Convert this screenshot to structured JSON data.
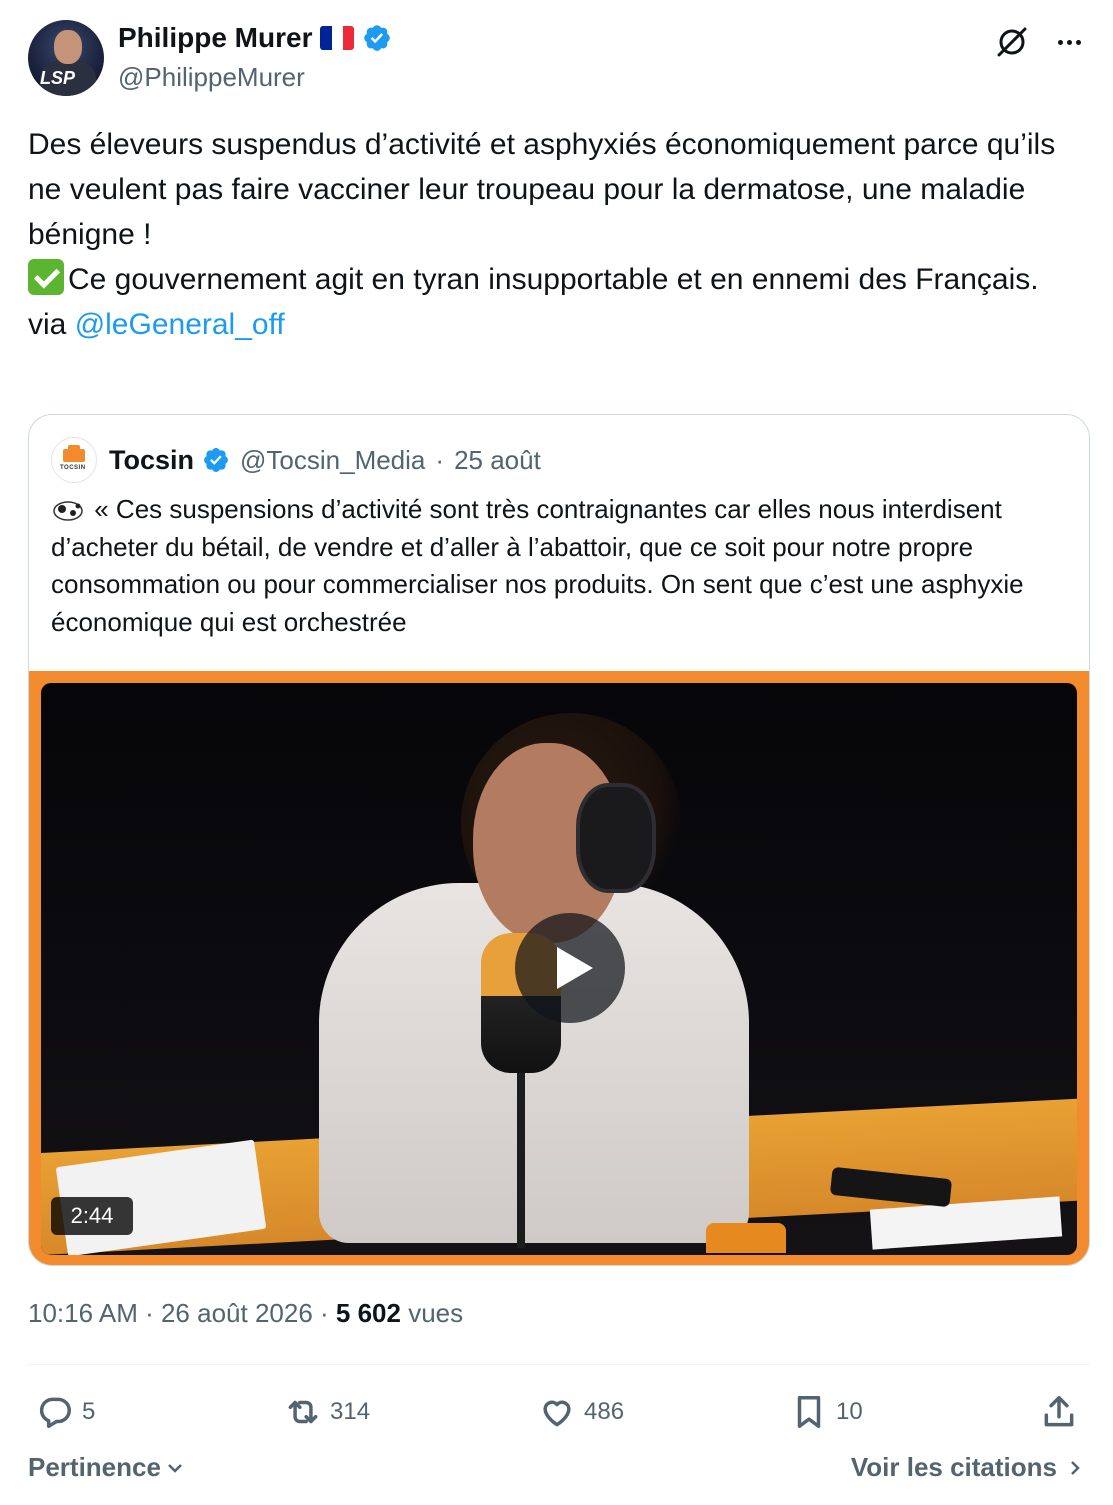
{
  "author": {
    "name": "Philippe Murer",
    "handle": "@PhilippeMurer",
    "flag_icon": "flag-france-icon",
    "verified_icon": "verified-badge-icon"
  },
  "tweet": {
    "line1": "Des éleveurs suspendus d’activité et asphyxiés économiquement parce qu’ils ne veulent pas faire vacciner leur troupeau pour la dermatose, une maladie bénigne !",
    "line2": "Ce gouvernement agit en tyran insupportable et en ennemi des Français.",
    "via_prefix": "via ",
    "mention": "@leGeneral_off"
  },
  "quote": {
    "name": "Tocsin",
    "handle": "@Tocsin_Media",
    "separator": " · ",
    "date": "25 août",
    "text": "« Ces suspensions d’activité sont très contraignantes car elles nous interdisent d’acheter du bétail, de vendre et d’aller à l’abattoir, que ce soit pour notre propre consommation ou pour commercialiser nos produits. On sent que c’est une asphyxie économique qui est orchestrée",
    "video_duration": "2:44",
    "avatar_logo_text": "TOCSIN"
  },
  "meta": {
    "time": "10:16 AM",
    "dot": " · ",
    "date": "26 août 2026",
    "views_count": "5 602",
    "views_label": " vues"
  },
  "actions": {
    "replies": "5",
    "reposts": "314",
    "likes": "486",
    "bookmarks": "10"
  },
  "footer": {
    "sort_label": "Pertinence",
    "quotes_link": "Voir les citations"
  },
  "colors": {
    "accent": "#1d9bf0",
    "text": "#0f1419",
    "muted": "#536471",
    "video_border": "#f28a2e"
  }
}
